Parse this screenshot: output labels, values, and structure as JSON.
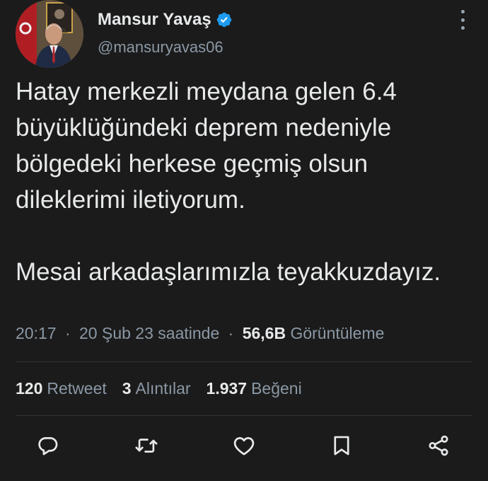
{
  "author": {
    "display_name": "Mansur Yavaş",
    "handle": "@mansuryavas06",
    "verified": true
  },
  "tweet": {
    "paragraphs": [
      "Hatay merkezli meydana gelen 6.4 büyüklüğündeki deprem nedeniyle bölgedeki herkese geçmiş olsun dileklerimi iletiyorum.",
      "Mesai arkadaşlarımızla teyakkuzdayız."
    ]
  },
  "meta": {
    "time": "20:17",
    "date": "20 Şub 23 saatinde",
    "views_count": "56,6B",
    "views_label": "Görüntüleme",
    "separator": "·"
  },
  "stats": {
    "retweets": {
      "count": "120",
      "label": "Retweet"
    },
    "quotes": {
      "count": "3",
      "label": "Alıntılar"
    },
    "likes": {
      "count": "1.937",
      "label": "Beğeni"
    }
  },
  "actions": [
    "reply-icon",
    "retweet-icon",
    "like-icon",
    "bookmark-icon",
    "share-icon"
  ],
  "colors": {
    "background": "#1b1b1b",
    "text": "#e7e9ea",
    "secondary": "#8b98a5",
    "verified": "#1d9bf0"
  }
}
